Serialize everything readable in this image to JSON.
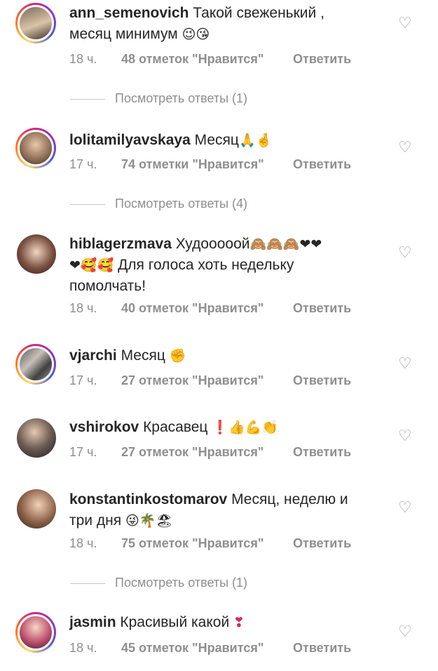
{
  "comments": [
    {
      "username": "ann_semenovich",
      "text": "Такой свеженький ,",
      "text2": "месяц минимум",
      "emoji": "😉😘",
      "time": "18 ч.",
      "likes": "48 отметок \"Нравится\"",
      "reply": "Ответить",
      "view_replies": "Посмотреть ответы (1)"
    },
    {
      "username": "lolitamilyavskaya",
      "text": "Месяц",
      "emoji": "🙏🤞",
      "time": "17 ч.",
      "likes": "74 отметки \"Нравится\"",
      "reply": "Ответить",
      "view_replies": "Посмотреть ответы (4)"
    },
    {
      "username": "hiblagerzmava",
      "text": "Худооооой",
      "emoji": "🙈🙈🙈❤❤",
      "emoji2": "❤🥰🥰",
      "text2": " Для голоса  хоть  недельку",
      "text3": "помолчать!",
      "time": "18 ч.",
      "likes": "40 отметок \"Нравится\"",
      "reply": "Ответить"
    },
    {
      "username": "vjarchi",
      "text": "Месяц",
      "emoji": "✊",
      "time": "17 ч.",
      "likes": "27 отметок \"Нравится\"",
      "reply": "Ответить"
    },
    {
      "username": "vshirokov",
      "text": "Красавец",
      "emoji": "❗👍💪👏",
      "time": "17 ч.",
      "likes": "27 отметок \"Нравится\"",
      "reply": "Ответить"
    },
    {
      "username": "konstantinkostomarov",
      "text": "Месяц, неделю и",
      "text2": "три дня",
      "emoji": "😜🌴🏖",
      "time": "18 ч.",
      "likes": "75 отметок \"Нравится\"",
      "reply": "Ответить",
      "view_replies": "Посмотреть ответы (1)"
    },
    {
      "username": "jasmin",
      "text": "Красивый какой",
      "emoji": "❣",
      "time": "18 ч.",
      "likes": "45 отметок \"Нравится\"",
      "reply": "Ответить"
    }
  ],
  "icons": {
    "like": "heart-outline-icon"
  },
  "colors": {
    "text": "#262626",
    "secondary": "#8e8e8e",
    "heart_emoji": "#e0245e"
  }
}
